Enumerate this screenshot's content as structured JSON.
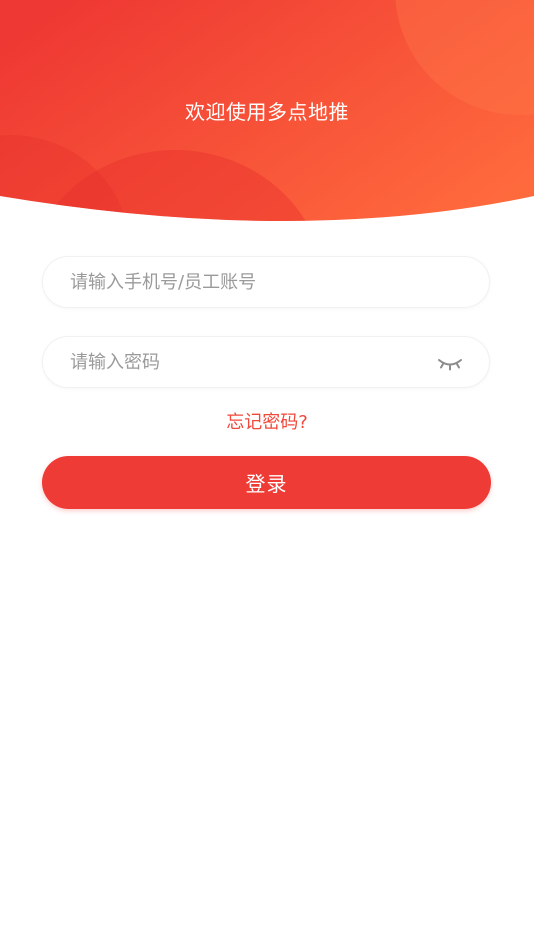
{
  "header": {
    "welcome_text": "欢迎使用多点地推",
    "gradient_start": "#ee3833",
    "gradient_end": "#ff6a3d"
  },
  "form": {
    "account_placeholder": "请输入手机号/员工账号",
    "account_value": "",
    "password_placeholder": "请输入密码",
    "password_value": "",
    "password_toggle_icon": "eye-closed-icon",
    "forgot_password_label": "忘记密码?",
    "login_label": "登录"
  },
  "colors": {
    "accent": "#ef3b36",
    "link": "#f0483b",
    "placeholder": "#9a9a9a"
  }
}
